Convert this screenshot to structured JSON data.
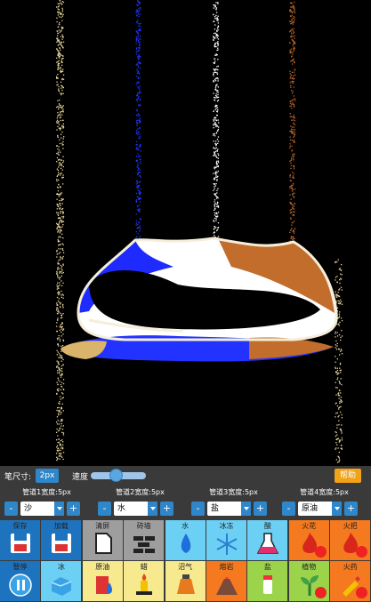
{
  "toolbar": {
    "brush_label": "笔尺寸:",
    "brush_value": "2px",
    "speed_label": "速度",
    "speed_level": 0.45,
    "help_label": "帮助"
  },
  "pipes": [
    {
      "label": "管道1宽度:5px",
      "value": "沙"
    },
    {
      "label": "管道2宽度:5px",
      "value": "水"
    },
    {
      "label": "管道3宽度:5px",
      "value": "盐"
    },
    {
      "label": "管道4宽度:5px",
      "value": "原油"
    }
  ],
  "pipe_minus": "-",
  "pipe_plus": "+",
  "tools_row1": [
    {
      "label": "保存",
      "color": "#1e73be",
      "icon": "save-icon"
    },
    {
      "label": "加载",
      "color": "#1e73be",
      "icon": "load-icon"
    },
    {
      "label": "清屏",
      "color": "#9e9e9e",
      "icon": "clear-icon"
    },
    {
      "label": "砖墙",
      "color": "#9e9e9e",
      "icon": "brick-icon"
    },
    {
      "label": "水",
      "color": "#6cd0f5",
      "icon": "water-icon"
    },
    {
      "label": "冰冻",
      "color": "#6cd0f5",
      "icon": "snowflake-icon"
    },
    {
      "label": "酸",
      "color": "#6cd0f5",
      "icon": "acid-icon"
    },
    {
      "label": "火花",
      "color": "#f4791f",
      "icon": "spark-icon",
      "locked": true
    },
    {
      "label": "火把",
      "color": "#f4791f",
      "icon": "torch-icon",
      "locked": true
    }
  ],
  "tools_row2": [
    {
      "label": "暂停",
      "color": "#1e73be",
      "icon": "pause-icon"
    },
    {
      "label": "冰",
      "color": "#6cd0f5",
      "icon": "ice-icon"
    },
    {
      "label": "原油",
      "color": "#f7e98e",
      "icon": "oil-icon"
    },
    {
      "label": "蜡",
      "color": "#f7e98e",
      "icon": "wax-icon"
    },
    {
      "label": "沼气",
      "color": "#f7e98e",
      "icon": "gas-icon"
    },
    {
      "label": "熔岩",
      "color": "#f4791f",
      "icon": "lava-icon"
    },
    {
      "label": "盐",
      "color": "#9bd44a",
      "icon": "salt-icon"
    },
    {
      "label": "植物",
      "color": "#9bd44a",
      "icon": "plant-icon",
      "locked": true
    },
    {
      "label": "火药",
      "color": "#f4791f",
      "icon": "gunpowder-icon",
      "locked": true
    }
  ]
}
